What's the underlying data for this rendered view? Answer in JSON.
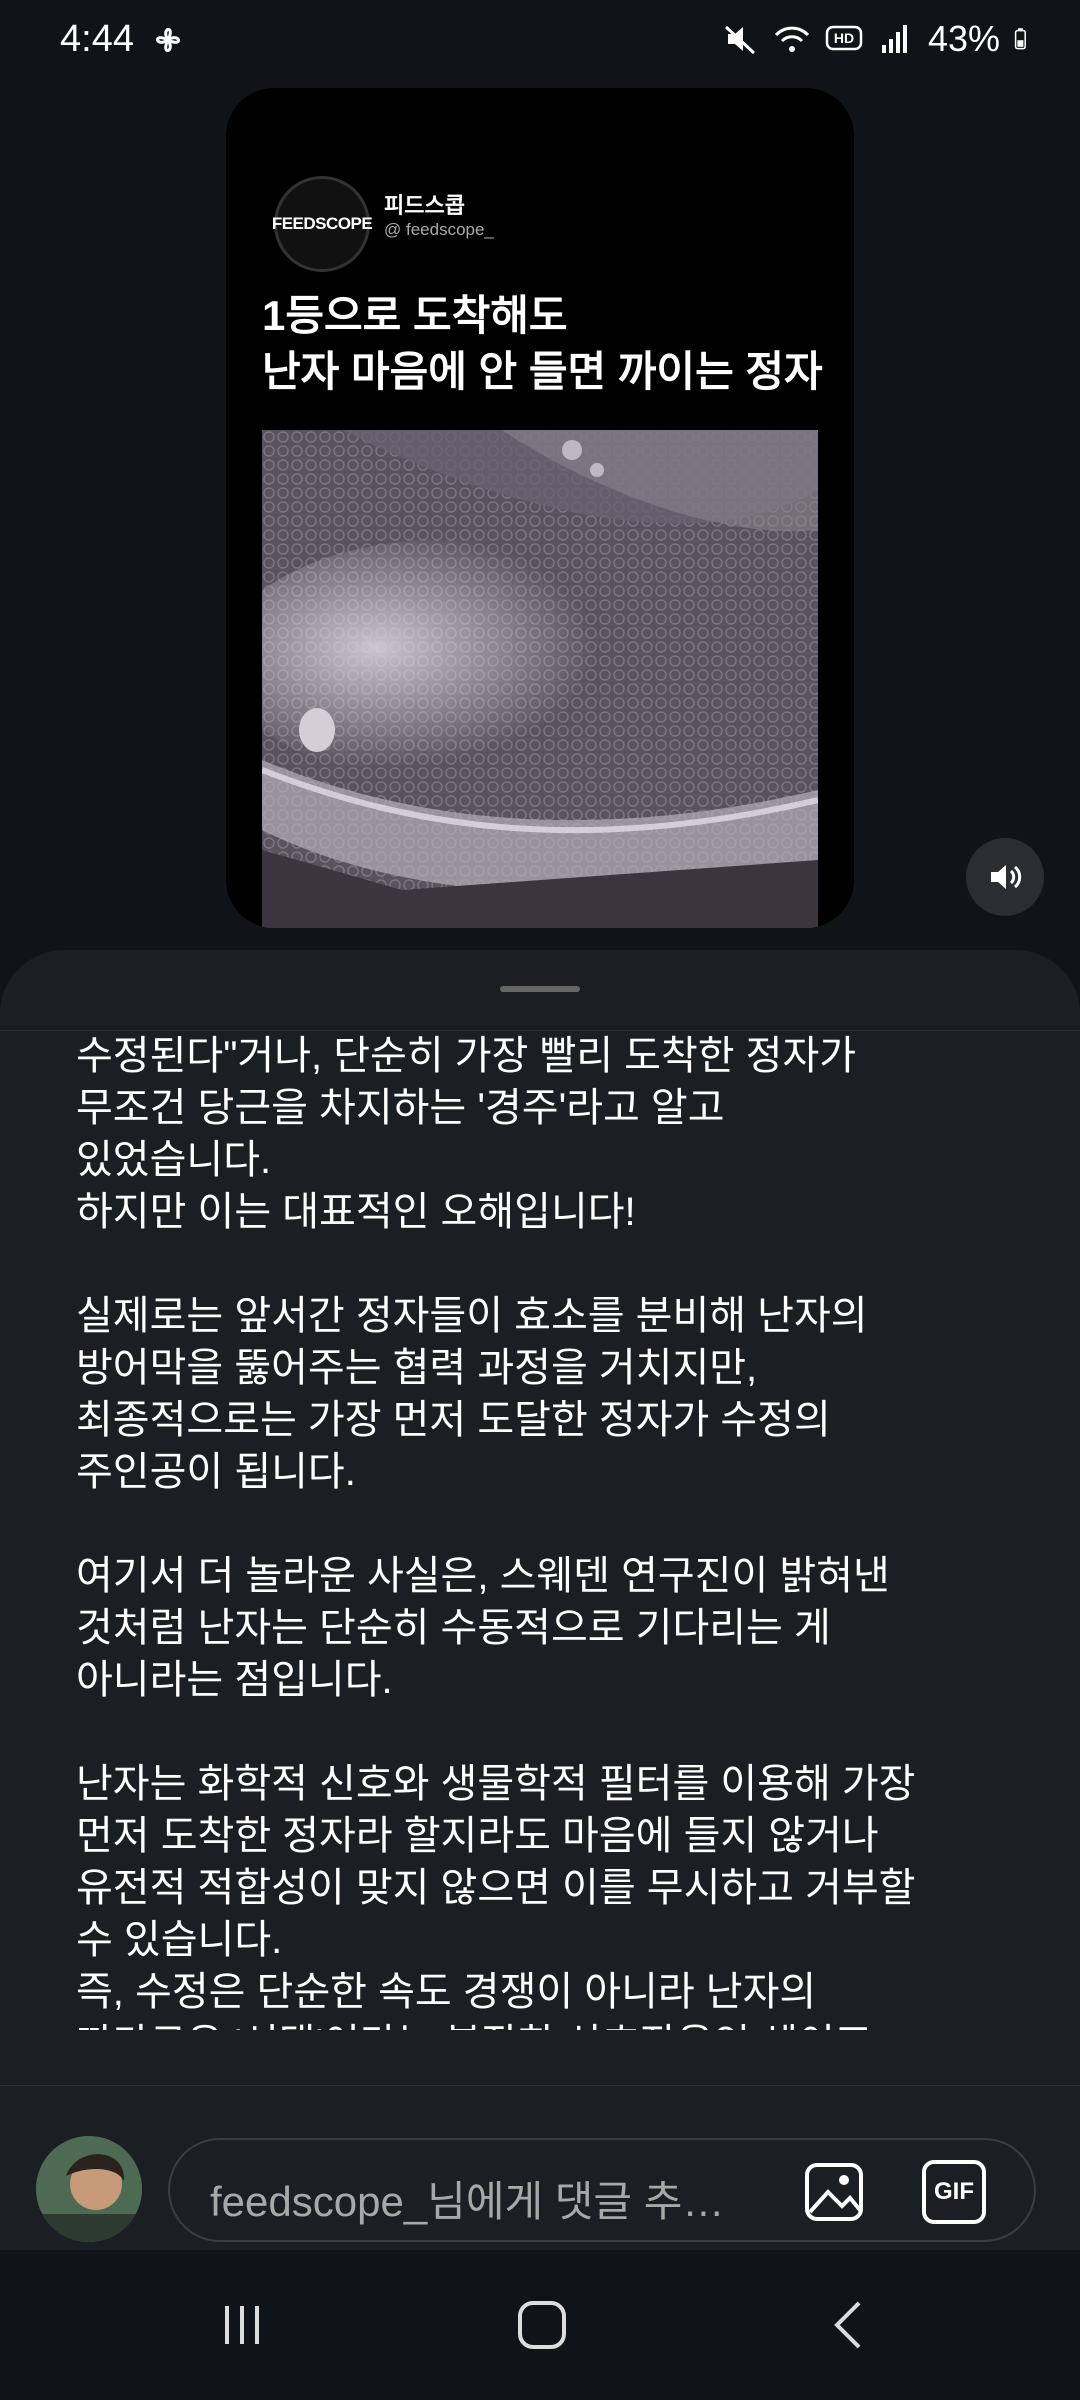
{
  "status_bar": {
    "time": "4:44",
    "battery": "43%",
    "network_badge": "HD",
    "icons": [
      "pinwheel-icon",
      "mute-icon",
      "wifi-icon",
      "hd-icon",
      "signal-icon",
      "battery-icon"
    ]
  },
  "reel": {
    "account_name": "피드스콥",
    "account_handle": "@ feedscope_",
    "avatar_logo": "FEEDSCOPE",
    "title_line1": "1등으로 도착해도",
    "title_line2": "난자 마음에 안 들면 까이는 정자"
  },
  "volume_icon": "volume-icon",
  "comment": {
    "lines": [
      "수정된다\"거나, 단순히 가장 빨리 도착한 정자가",
      "무조건 당근을 차지하는 '경주'라고 알고",
      "있었습니다.",
      "하지만 이는 대표적인 오해입니다!",
      "",
      "실제로는 앞서간 정자들이 효소를 분비해 난자의",
      "방어막을 뚫어주는 협력 과정을 거치지만,",
      "최종적으로는 가장 먼저 도달한 정자가 수정의",
      "주인공이 됩니다.",
      "",
      "여기서 더 놀라운 사실은, 스웨덴 연구진이 밝혀낸",
      "것처럼 난자는 단순히 수동적으로 기다리는 게",
      "아니라는 점입니다.",
      "",
      "난자는 화학적 신호와 생물학적 필터를 이용해 가장",
      "먼저 도착한 정자라 할지라도 마음에 들지 않거나",
      "유전적 적합성이 맞지 않으면 이를 무시하고 거부할",
      "수 있습니다.",
      "즉, 수정은 단순한 속도 경쟁이 아니라 난자의",
      "까다로운 '선택'이라는 복잡한 상호작용인 셈이죠."
    ]
  },
  "input": {
    "placeholder": "feedscope_님에게 댓글 추가...",
    "gif_label": "GIF"
  },
  "nav": {
    "recents": "recents-icon",
    "home": "home-icon",
    "back": "back-icon"
  }
}
